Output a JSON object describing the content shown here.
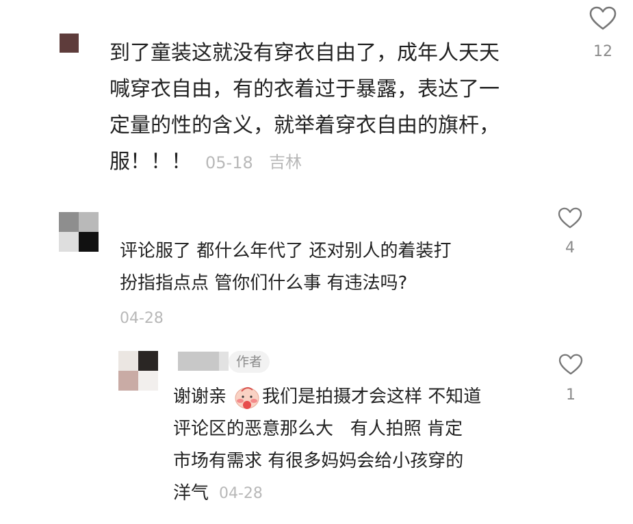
{
  "comments": [
    {
      "body_lines": [
        "到了童装这就没有穿衣自由了，成年人天天",
        "喊穿衣自由，有的衣着过于暴露，表达了一",
        "定量的性的含义，就举着穿衣自由的旗杆，",
        "服！！！"
      ],
      "date": "05-18",
      "location": "吉林",
      "likes": "12"
    },
    {
      "body_lines": [
        "评论服了 都什么年代了 还对别人的着装打",
        "扮指指点点 管你们什么事 有违法吗?"
      ],
      "date": "04-28",
      "likes": "4"
    },
    {
      "author_badge": "作者",
      "body_lines": [
        "谢谢亲",
        "我们是拍摄才会这样 不知道",
        "评论区的恶意那么大   有人拍照 肯定",
        "市场有需求 有很多妈妈会给小孩穿的",
        "洋气"
      ],
      "date": "04-28",
      "likes": "1"
    }
  ],
  "icons": {
    "like": "heart-icon",
    "emoji": "shy-face-emoji-icon"
  },
  "colors": {
    "text": "#222222",
    "meta": "#b8b8b8",
    "count": "#8a8a8a",
    "badge_bg": "#f2f2f2"
  }
}
